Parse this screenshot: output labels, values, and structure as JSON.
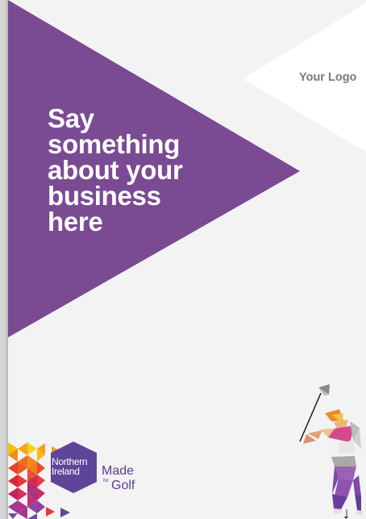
{
  "document": {
    "headline_lines": [
      "Say",
      "something",
      "about your",
      "business",
      "here"
    ],
    "logo_placeholder": "Your Logo"
  },
  "brand": {
    "badge_line1": "Northern",
    "badge_line2": "Ireland",
    "made": "Made",
    "for": "for",
    "golf": "Golf"
  },
  "colors": {
    "purple": "#7a4a93",
    "page_background": "#f3f3f4",
    "logo_text": "#7a7a7a",
    "badge": "#5e4598"
  },
  "icons": [
    "golfer-illustration",
    "triangle-mosaic-decoration",
    "hexagon-badge"
  ]
}
